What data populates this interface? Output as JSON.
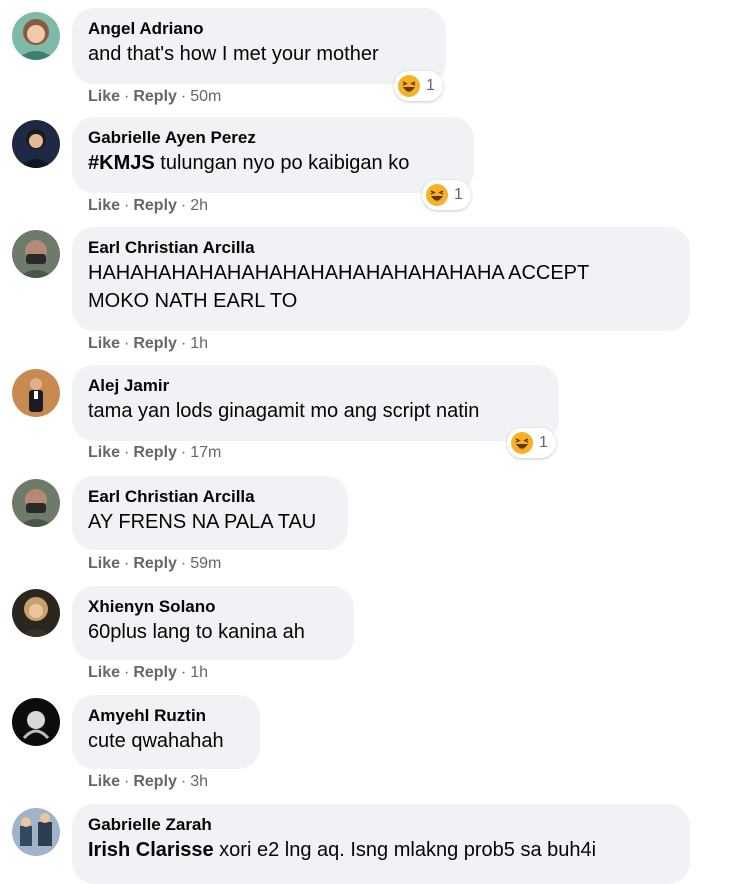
{
  "actions": {
    "like": "Like",
    "reply": "Reply",
    "separator": "·"
  },
  "comments": [
    {
      "author": "Angel Adriano",
      "text": "and that's how I met your mother",
      "time": "50m",
      "reaction": {
        "type": "haha",
        "count": "1"
      }
    },
    {
      "author": "Gabrielle Ayen Perez",
      "tag": "#KMJS",
      "text": " tulungan nyo po kaibigan ko",
      "time": "2h",
      "reaction": {
        "type": "haha",
        "count": "1"
      }
    },
    {
      "author": "Earl Christian Arcilla",
      "text_line1": "HAHAHAHAHAHAHAHAHAHAHAHAHAHAHA ACCEPT",
      "text_line2": "MOKO NATH EARL TO",
      "time": "1h"
    },
    {
      "author": "Alej Jamir",
      "text": "tama yan lods ginagamit mo ang script natin",
      "time": "17m",
      "reaction": {
        "type": "haha",
        "count": "1"
      }
    },
    {
      "author": "Earl Christian Arcilla",
      "text": "AY FRENS NA PALA TAU",
      "time": "59m"
    },
    {
      "author": "Xhienyn Solano",
      "text": "60plus lang to kanina ah",
      "time": "1h"
    },
    {
      "author": "Amyehl Ruztin",
      "text": "cute qwahahah",
      "time": "3h"
    },
    {
      "author": "Gabrielle Zarah",
      "mention": "Irish Clarisse",
      "text": " xori e2 lng aq. Isng mlakng prob5 sa buh4i"
    }
  ],
  "colors": {
    "bubble": "#f0f2f5",
    "meta": "#65676b",
    "text": "#050505",
    "emoji_face": "#f7b125"
  }
}
